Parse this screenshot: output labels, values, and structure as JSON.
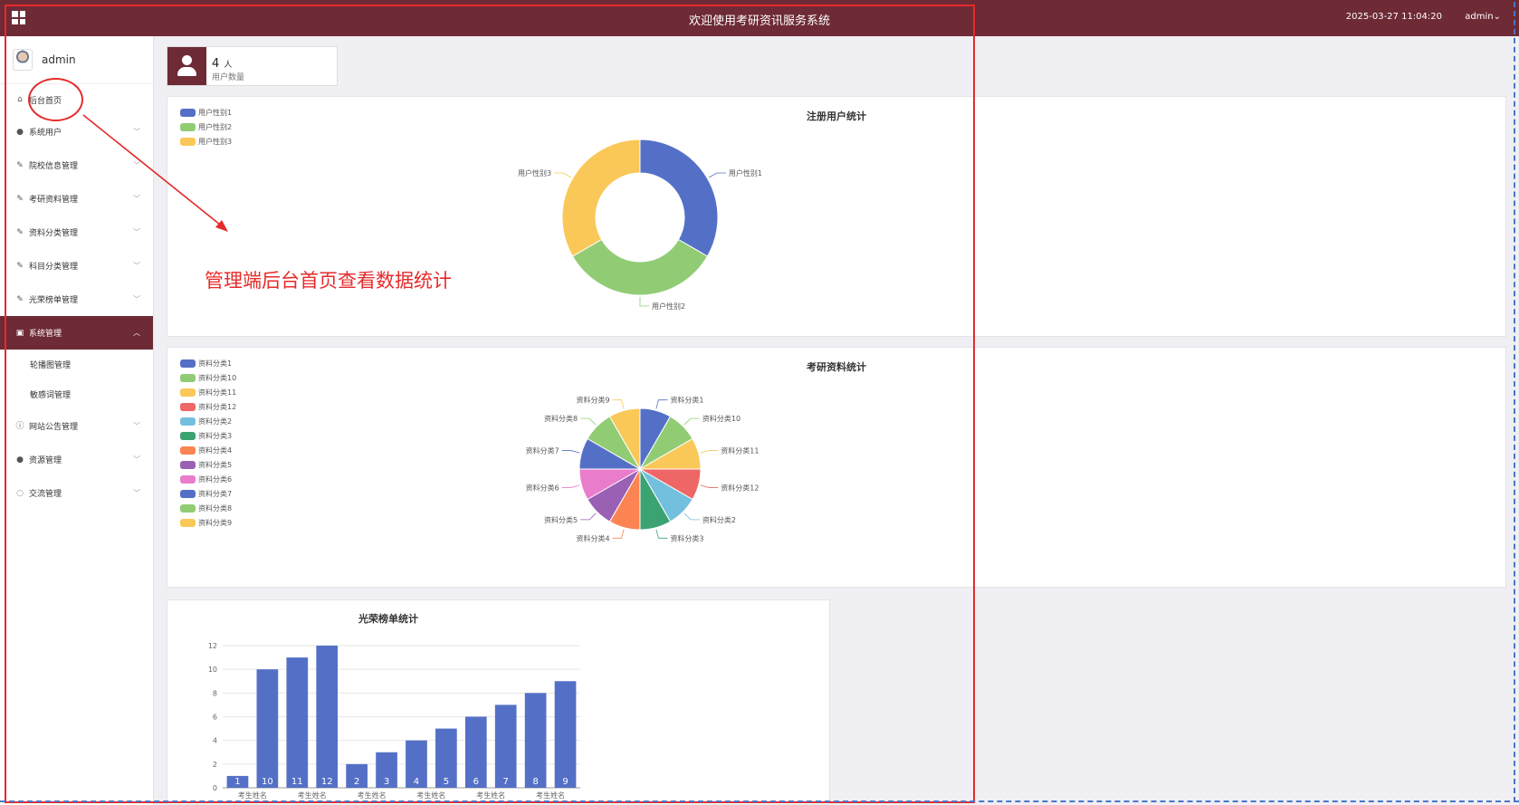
{
  "header": {
    "title": "欢迎使用考研资讯服务系统",
    "datetime": "2025-03-27 11:04:20",
    "user": "admin⌄"
  },
  "sidebar": {
    "username": "admin",
    "items": [
      {
        "label": "后台首页",
        "icon": "home-icon"
      },
      {
        "label": "系统用户",
        "icon": "user-icon"
      },
      {
        "label": "院校信息管理",
        "icon": "edit-icon"
      },
      {
        "label": "考研资料管理",
        "icon": "edit-icon"
      },
      {
        "label": "资料分类管理",
        "icon": "edit-icon"
      },
      {
        "label": "科目分类管理",
        "icon": "edit-icon"
      },
      {
        "label": "光荣榜单管理",
        "icon": "edit-icon"
      },
      {
        "label": "系统管理",
        "icon": "picture-icon"
      },
      {
        "label": "网站公告管理",
        "icon": "info-icon"
      },
      {
        "label": "资源管理",
        "icon": "location-icon"
      },
      {
        "label": "交流管理",
        "icon": "chat-icon"
      }
    ],
    "sub_items": [
      "轮播图管理",
      "敏感词管理"
    ]
  },
  "stats": {
    "user_count": "4",
    "unit": "人",
    "label": "用户数量"
  },
  "charts_text": {
    "users_title": "注册用户统计",
    "materials_title": "考研资料统计",
    "honor_title": "光荣榜单统计"
  },
  "annotation": {
    "text": "管理端后台首页查看数据统计"
  },
  "colors": {
    "brand": "#6e2a35",
    "annotation": "#e52b2b",
    "palette": [
      "#5470c6",
      "#91cc75",
      "#fac858",
      "#ee6666",
      "#73c0de",
      "#3ba272",
      "#fc8452",
      "#9a60b4",
      "#ea7ccc"
    ]
  },
  "chart_data": [
    {
      "type": "pie",
      "title": "注册用户统计",
      "donut": true,
      "legend": "top-left",
      "categories": [
        "用户性别1",
        "用户性别2",
        "用户性别3"
      ],
      "values": [
        1,
        1,
        1
      ]
    },
    {
      "type": "pie",
      "title": "考研资料统计",
      "legend": "top-left",
      "categories": [
        "资料分类1",
        "资料分类10",
        "资料分类11",
        "资料分类12",
        "资料分类2",
        "资料分类3",
        "资料分类4",
        "资料分类5",
        "资料分类6",
        "资料分类7",
        "资料分类8",
        "资料分类9"
      ],
      "values": [
        1,
        1,
        1,
        1,
        1,
        1,
        1,
        1,
        1,
        1,
        1,
        1
      ]
    },
    {
      "type": "bar",
      "title": "光荣榜单统计",
      "categories": [
        "考生姓名",
        "考生姓名",
        "考生姓名",
        "考生姓名",
        "考生姓名",
        "考生姓名",
        "考生姓名",
        "考生姓名",
        "考生姓名",
        "考生姓名",
        "考生姓名",
        "考生姓名"
      ],
      "values": [
        1,
        10,
        11,
        12,
        2,
        3,
        4,
        5,
        6,
        7,
        8,
        9
      ],
      "ylim": [
        0,
        12
      ],
      "yticks": [
        0,
        2,
        4,
        6,
        8,
        10,
        12
      ],
      "xtick_labels_shown": [
        "考生姓名",
        "考生姓名",
        "考生姓名",
        "考生姓名",
        "考生姓名",
        "考生姓名"
      ],
      "grid": true
    }
  ]
}
